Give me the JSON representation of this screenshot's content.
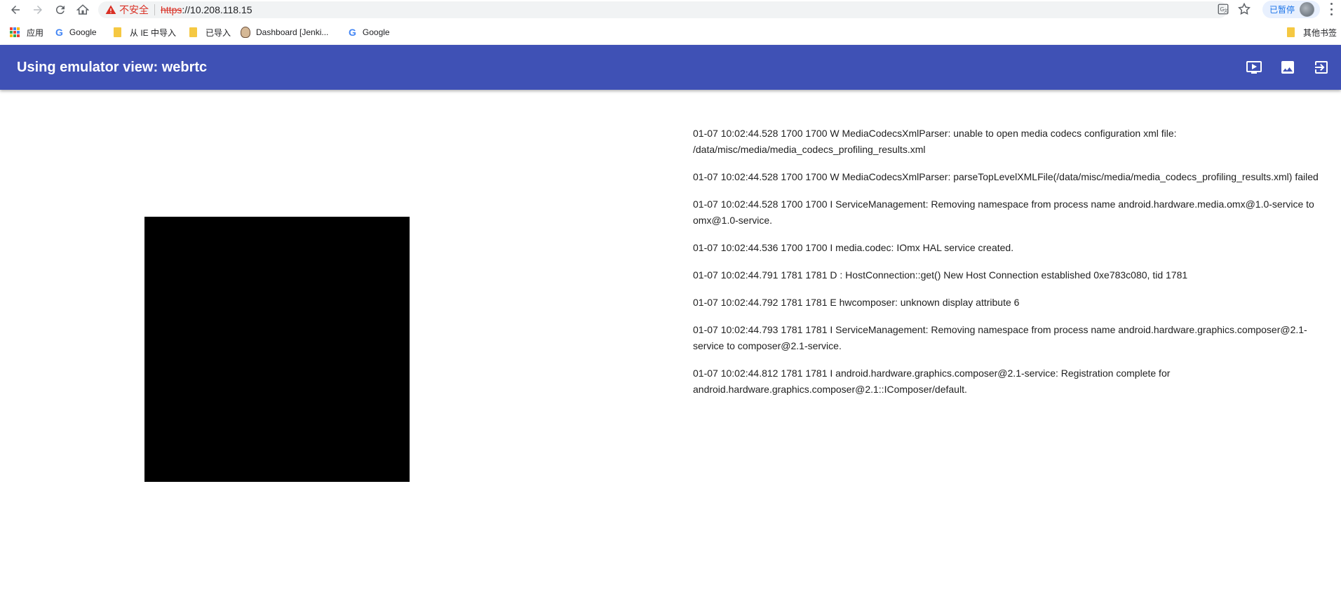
{
  "browser": {
    "security_label": "不安全",
    "url_scheme": "https",
    "url_rest": "://10.208.118.15",
    "paused_label": "已暂停"
  },
  "bookmarks": {
    "apps_label": "应用",
    "items": [
      {
        "label": "Google",
        "icon": "google-icon"
      },
      {
        "label": "从 IE 中导入",
        "icon": "folder-icon"
      },
      {
        "label": "已导入",
        "icon": "folder-icon"
      },
      {
        "label": "Dashboard [Jenki...",
        "icon": "jenkins-icon"
      },
      {
        "label": "Google",
        "icon": "google-icon"
      }
    ],
    "other_label": "其他书签"
  },
  "appbar": {
    "title": "Using emulator view: webrtc",
    "color": "#3f51b5",
    "actions": [
      "live-view-icon",
      "screenshot-icon",
      "logout-icon"
    ]
  },
  "logcat": {
    "lines": [
      "01-07 10:02:44.528 1700 1700 W MediaCodecsXmlParser: unable to open media codecs configuration xml file: /data/misc/media/media_codecs_profiling_results.xml",
      "01-07 10:02:44.528 1700 1700 W MediaCodecsXmlParser: parseTopLevelXMLFile(/data/misc/media/media_codecs_profiling_results.xml) failed",
      "01-07 10:02:44.528 1700 1700 I ServiceManagement: Removing namespace from process name android.hardware.media.omx@1.0-service to omx@1.0-service.",
      "01-07 10:02:44.536 1700 1700 I media.codec: IOmx HAL service created.",
      "01-07 10:02:44.791 1781 1781 D : HostConnection::get() New Host Connection established 0xe783c080, tid 1781",
      "01-07 10:02:44.792 1781 1781 E hwcomposer: unknown display attribute 6",
      "01-07 10:02:44.793 1781 1781 I ServiceManagement: Removing namespace from process name android.hardware.graphics.composer@2.1-service to composer@2.1-service.",
      "01-07 10:02:44.812 1781 1781 I android.hardware.graphics.composer@2.1-service: Registration complete for android.hardware.graphics.composer@2.1::IComposer/default."
    ]
  }
}
